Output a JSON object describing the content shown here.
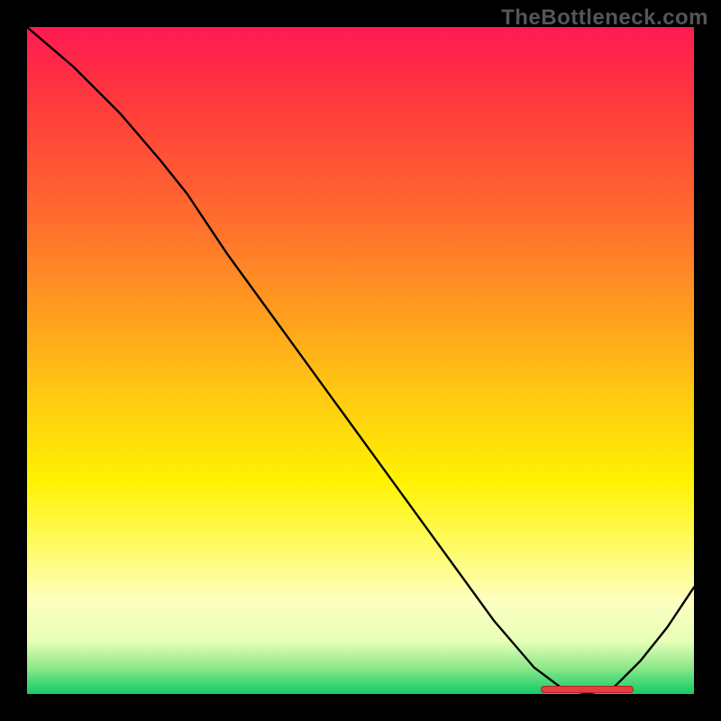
{
  "credit": "TheBottleneck.com",
  "colors": {
    "gradient_top": "#ff1a52",
    "gradient_bottom": "#1fc766",
    "curve": "#000000",
    "marker": "#e04040",
    "frame": "#000000"
  },
  "chart_data": {
    "type": "line",
    "title": "",
    "xlabel": "",
    "ylabel": "",
    "xlim": [
      0,
      100
    ],
    "ylim": [
      0,
      100
    ],
    "grid": false,
    "series": [
      {
        "name": "bottleneck-curve",
        "x": [
          0,
          7,
          14,
          20,
          24,
          30,
          38,
          46,
          54,
          62,
          70,
          76,
          80,
          84,
          88,
          92,
          96,
          100
        ],
        "y": [
          100,
          94,
          87,
          80,
          75,
          66,
          55,
          44,
          33,
          22,
          11,
          4,
          1,
          0,
          1,
          5,
          10,
          16
        ]
      }
    ],
    "annotations": [
      {
        "name": "optimal-range-marker",
        "x_start": 77,
        "x_end": 91,
        "y": 0.7
      }
    ]
  }
}
